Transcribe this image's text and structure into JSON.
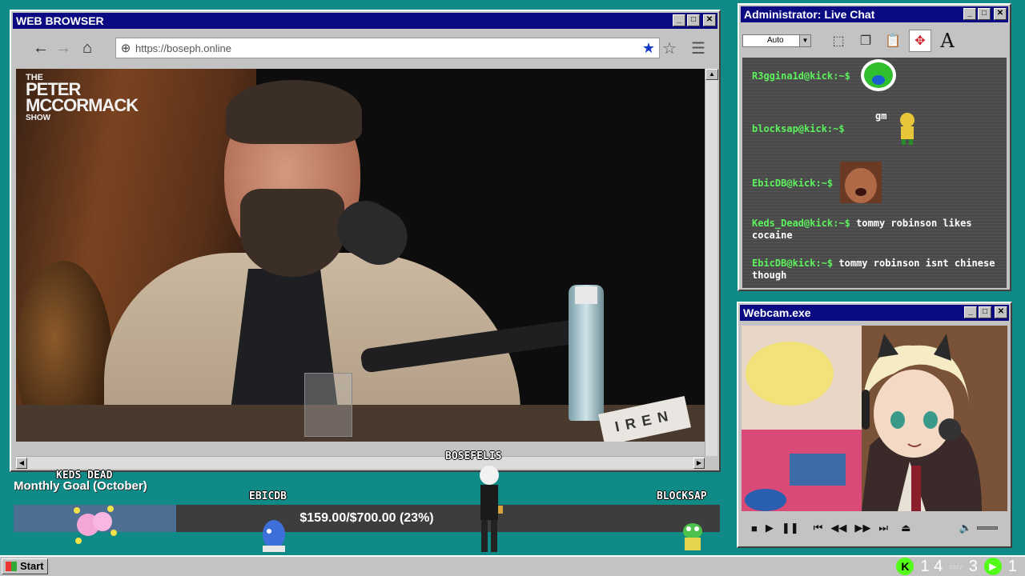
{
  "browser": {
    "title": "WEB BROWSER",
    "url": "https://boseph.online",
    "video": {
      "show_logo": [
        "THE",
        "PETER MCCORMACK",
        "SHOW"
      ],
      "sign_text": "IREN"
    }
  },
  "donation": {
    "label": "Monthly Goal (October)",
    "progress_text": "$159.00/$700.00 (23%)",
    "progress": 0.23,
    "sprites": [
      "KEDS DEAD",
      "EBICDB",
      "BOSEFELIS",
      "BLOCKSAP"
    ]
  },
  "chat": {
    "title": "Administrator: Live Chat",
    "dropdown_value": "Auto",
    "messages": [
      {
        "user": "R3ggina1d@kick:~$",
        "text": "",
        "emote": "green-sticker"
      },
      {
        "user": "blocksap@kick:~$",
        "text": "gm",
        "emote": "pixel-character"
      },
      {
        "user": "EbicDB@kick:~$",
        "text": "",
        "emote": "face-emote"
      },
      {
        "user": "Keds_Dead@kick:~$",
        "text": "tommy robinson likes cocaine"
      },
      {
        "user": "EbicDB@kick:~$",
        "text": "tommy robinson isnt chinese though"
      }
    ]
  },
  "webcam": {
    "title": "Webcam.exe"
  },
  "taskbar": {
    "start_label": "Start",
    "count_a": "1 4",
    "cozy_label": "cozy",
    "count_b": "3",
    "count_c": "1"
  },
  "colors": {
    "desktop": "#0f8a86",
    "titlebar": "#0a0a82",
    "chat_user": "#5cf25c",
    "goal_fill": "#4e6f94",
    "kick_green": "#53fc18"
  }
}
